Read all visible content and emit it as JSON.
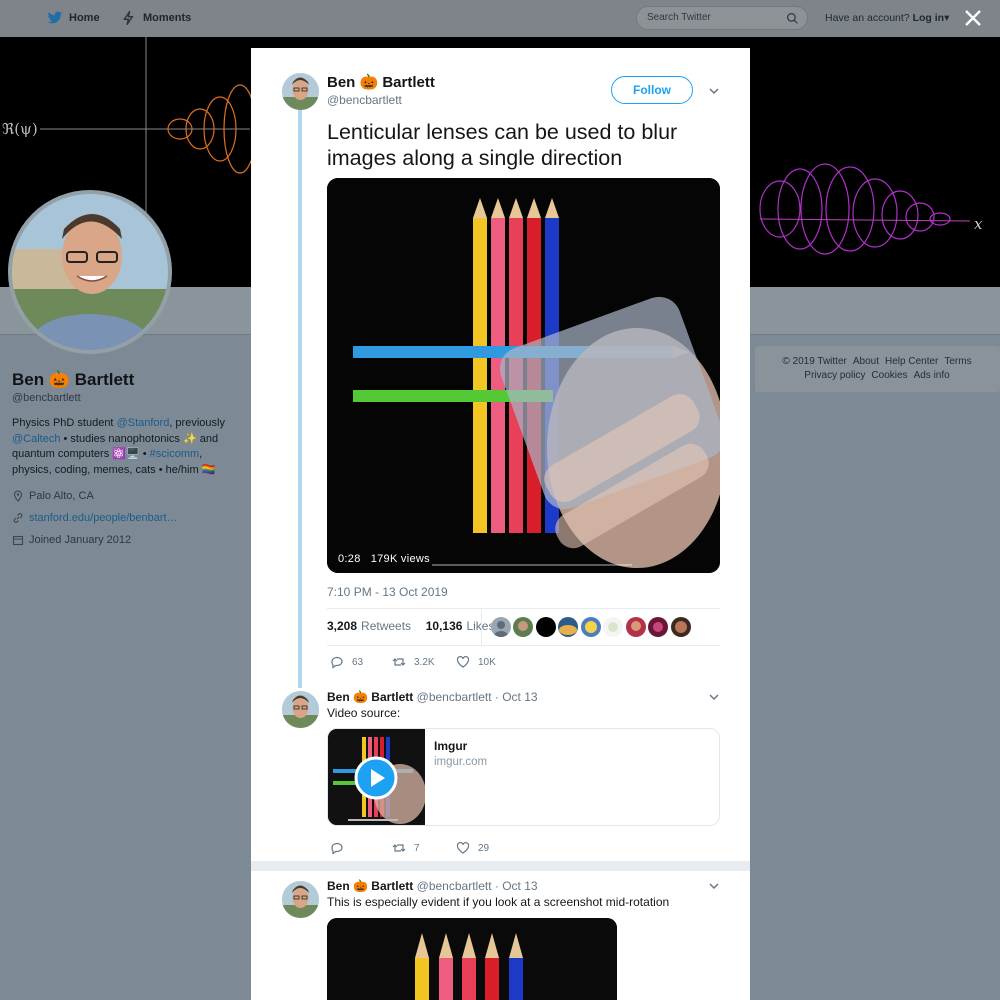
{
  "nav": {
    "home_label": "Home",
    "moments_label": "Moments",
    "search_placeholder": "Search Twitter",
    "account_prefix": "Have an account?",
    "login_label": "Log in"
  },
  "profile": {
    "name": "Ben 🎃 Bartlett",
    "handle": "@bencbartlett",
    "bio_1": "Physics PhD student ",
    "bio_stanford": "@Stanford",
    "bio_2": ", previously",
    "bio_caltech": "@Caltech",
    "bio_3": " • studies nanophotonics ✨ and quantum computers ⚛️🖥️ • ",
    "bio_scicomm": "#scicomm",
    "bio_4": ", physics, coding, memes, cats • he/him 🏳️‍🌈",
    "location": "Palo Alto, CA",
    "website": "stanford.edu/people/benbart…",
    "joined": "Joined January 2012",
    "banner_label_left": "ℜ(ψ)",
    "banner_label_right": "x"
  },
  "footer": {
    "copyright": "© 2019 Twitter",
    "about": "About",
    "help": "Help Center",
    "terms": "Terms",
    "privacy": "Privacy policy",
    "cookies": "Cookies",
    "ads": "Ads info"
  },
  "main_tweet": {
    "name": "Ben 🎃 Bartlett",
    "handle": "@bencbartlett",
    "follow_label": "Follow",
    "text": "Lenticular lenses can be used to blur images along a single direction",
    "video_time": "0:28",
    "video_views": "179K views",
    "timestamp": "7:10 PM - 13 Oct 2019",
    "retweets_count": "3,208",
    "retweets_label": "Retweets",
    "likes_count": "10,136",
    "likes_label": "Likes",
    "reply_count": "63",
    "retweet_count_short": "3.2K",
    "like_count_short": "10K"
  },
  "reply_1": {
    "name": "Ben 🎃 Bartlett",
    "handle_date": "@bencbartlett · Oct 13",
    "text": "Video source:",
    "card_title": "Imgur",
    "card_domain": "imgur.com",
    "retweets": "7",
    "likes": "29"
  },
  "reply_2": {
    "name": "Ben 🎃 Bartlett",
    "handle_date": "@bencbartlett · Oct 13",
    "text": "This is especially evident if you look at a screenshot mid-rotation"
  },
  "colors": {
    "accent": "#1da1f2",
    "overlay": "#7d8a95",
    "thread_line": "#b1d8f1"
  }
}
